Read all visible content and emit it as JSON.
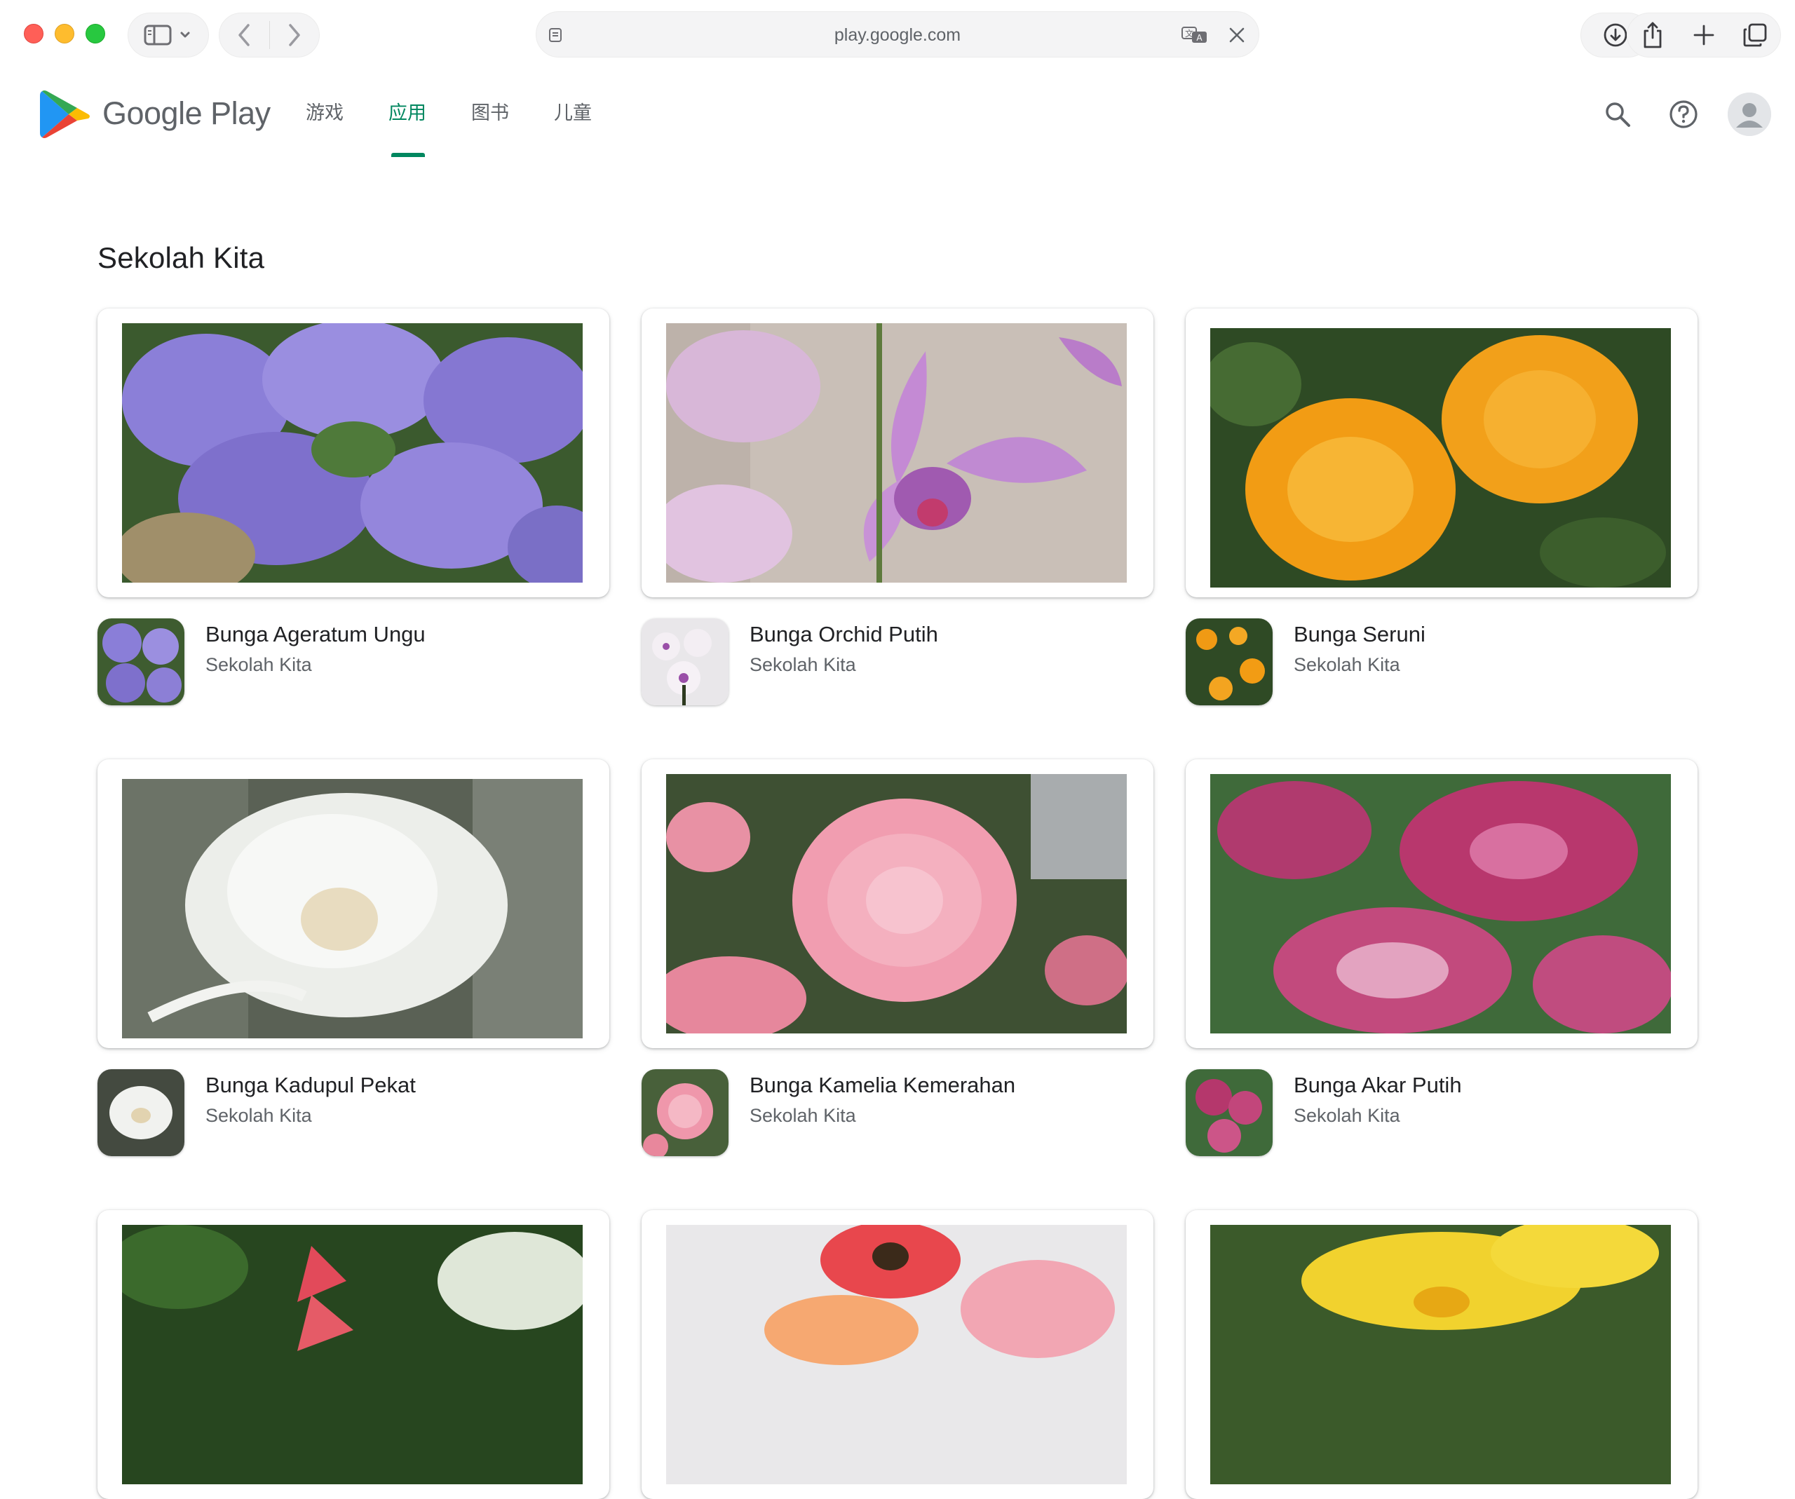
{
  "browser": {
    "url": "play.google.com"
  },
  "header": {
    "brand": "Google Play",
    "tabs": [
      {
        "label": "游戏",
        "active": false
      },
      {
        "label": "应用",
        "active": true
      },
      {
        "label": "图书",
        "active": false
      },
      {
        "label": "儿童",
        "active": false
      }
    ]
  },
  "section": {
    "title": "Sekolah Kita"
  },
  "apps": [
    {
      "name": "Bunga Ageratum Ungu",
      "developer": "Sekolah Kita",
      "image": "purple ageratum flowers"
    },
    {
      "name": "Bunga Orchid Putih",
      "developer": "Sekolah Kita",
      "image": "lilac orchid"
    },
    {
      "name": "Bunga Seruni",
      "developer": "Sekolah Kita",
      "image": "orange marigold"
    },
    {
      "name": "Bunga Kadupul Pekat",
      "developer": "Sekolah Kita",
      "image": "white night-blooming flower"
    },
    {
      "name": "Bunga Kamelia Kemerahan",
      "developer": "Sekolah Kita",
      "image": "pink camellia"
    },
    {
      "name": "Bunga Akar Putih",
      "developer": "Sekolah Kita",
      "image": "pink milkweed cluster"
    }
  ],
  "partial_row": [
    "red heliconia",
    "gerbera daisies",
    "yellow frangipani"
  ],
  "colors": {
    "accent": "#01875f",
    "text_primary": "#202124",
    "text_secondary": "#5f6368"
  }
}
